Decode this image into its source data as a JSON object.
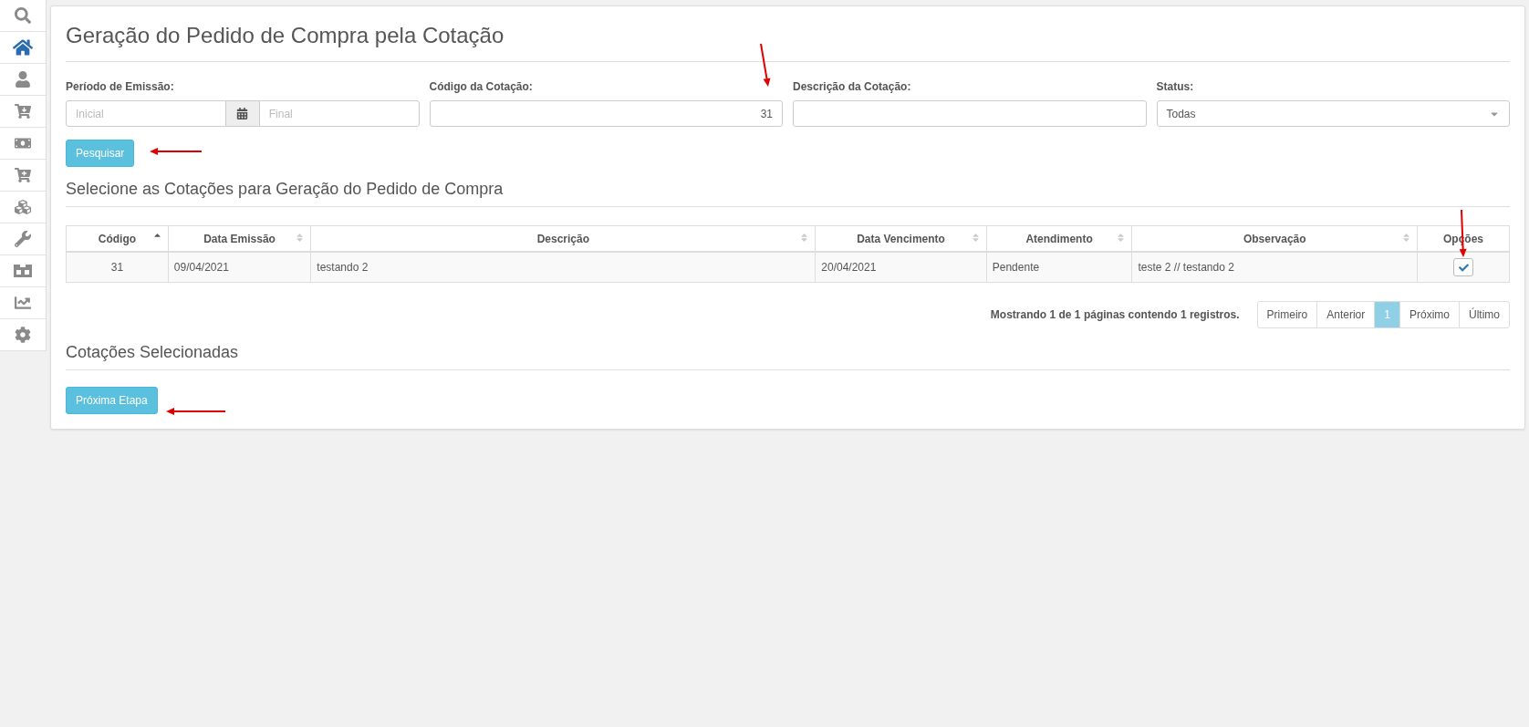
{
  "sidebar": {
    "items": [
      {
        "selected": false
      },
      {
        "selected": true
      },
      {
        "selected": false
      },
      {
        "selected": false
      },
      {
        "selected": false
      },
      {
        "selected": false
      },
      {
        "selected": false
      },
      {
        "selected": false
      },
      {
        "selected": false
      },
      {
        "selected": false
      },
      {
        "selected": false
      }
    ]
  },
  "title": "Geração do Pedido de Compra pela Cotação",
  "filters": {
    "period": {
      "label": "Período de Emissão:",
      "start_placeholder": "Inicial",
      "end_placeholder": "Final"
    },
    "code": {
      "label": "Código da Cotação:",
      "value": "31"
    },
    "description": {
      "label": "Descrição da Cotação:"
    },
    "status": {
      "label": "Status:",
      "value": "Todas"
    },
    "search_button": "Pesquisar"
  },
  "results": {
    "heading": "Selecione as Cotações para Geração do Pedido de Compra",
    "columns": [
      {
        "label": "Código",
        "sorted": true
      },
      {
        "label": "Data Emissão",
        "sorted": false
      },
      {
        "label": "Descrição",
        "sorted": false
      },
      {
        "label": "Data Vencimento",
        "sorted": false
      },
      {
        "label": "Atendimento",
        "sorted": false
      },
      {
        "label": "Observação",
        "sorted": false
      },
      {
        "label": "Opções"
      }
    ],
    "rows": [
      {
        "cells": [
          "31",
          "09/04/2021",
          "testando 2",
          "20/04/2021",
          "Pendente",
          "teste 2 // testando 2"
        ],
        "checked": true
      }
    ],
    "summary": "Mostrando 1 de 1 páginas contendo 1 registros.",
    "pages": [
      {
        "label": "Primeiro",
        "selected": false
      },
      {
        "label": "Anterior",
        "selected": false
      },
      {
        "label": "1",
        "selected": true
      },
      {
        "label": "Próximo",
        "selected": false
      },
      {
        "label": "Último",
        "selected": false
      }
    ]
  },
  "selected_section": {
    "heading": "Cotações Selecionadas",
    "next_button": "Próxima Etapa"
  }
}
